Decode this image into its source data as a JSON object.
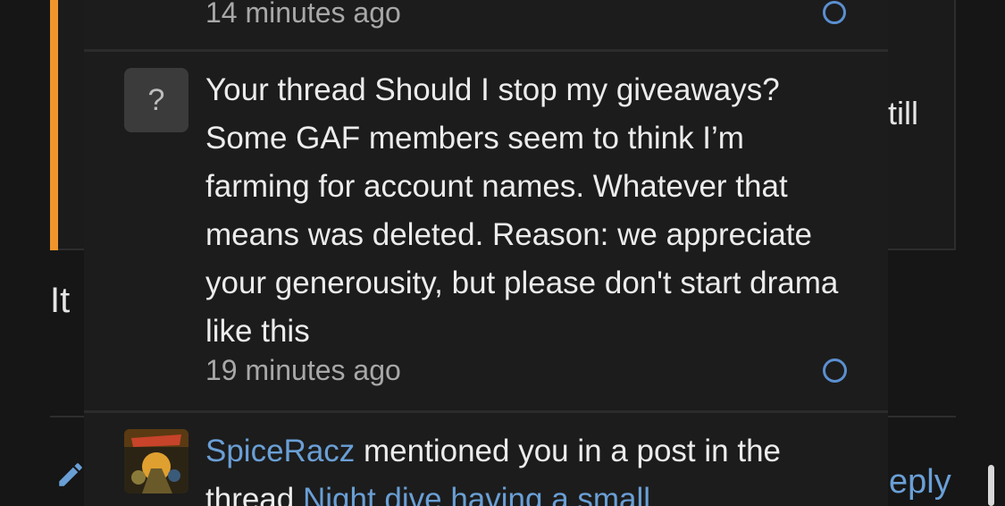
{
  "background": {
    "partial_text_right": "till",
    "partial_text_left": "It",
    "reply_partial": "eply",
    "accent_color": "#f0952b"
  },
  "notifications": [
    {
      "time": "14 minutes ago",
      "unread": true
    },
    {
      "avatar_glyph": "?",
      "text": "Your thread Should I stop my giveaways? Some GAF members seem to think I’m farming for account names. Whatever that means was deleted. Reason: we appreciate your generousity, but please don't start drama like this",
      "time": "19 minutes ago",
      "unread": true
    },
    {
      "username": "SpiceRacz",
      "text_mid": " mentioned you in a post in the thread ",
      "thread_title": "Night dive having a small"
    }
  ],
  "icons": {
    "pencil": "pencil-icon",
    "unread": "unread-dot-icon"
  },
  "colors": {
    "link": "#6a9fd6",
    "unread_ring": "#5b8fd0"
  }
}
